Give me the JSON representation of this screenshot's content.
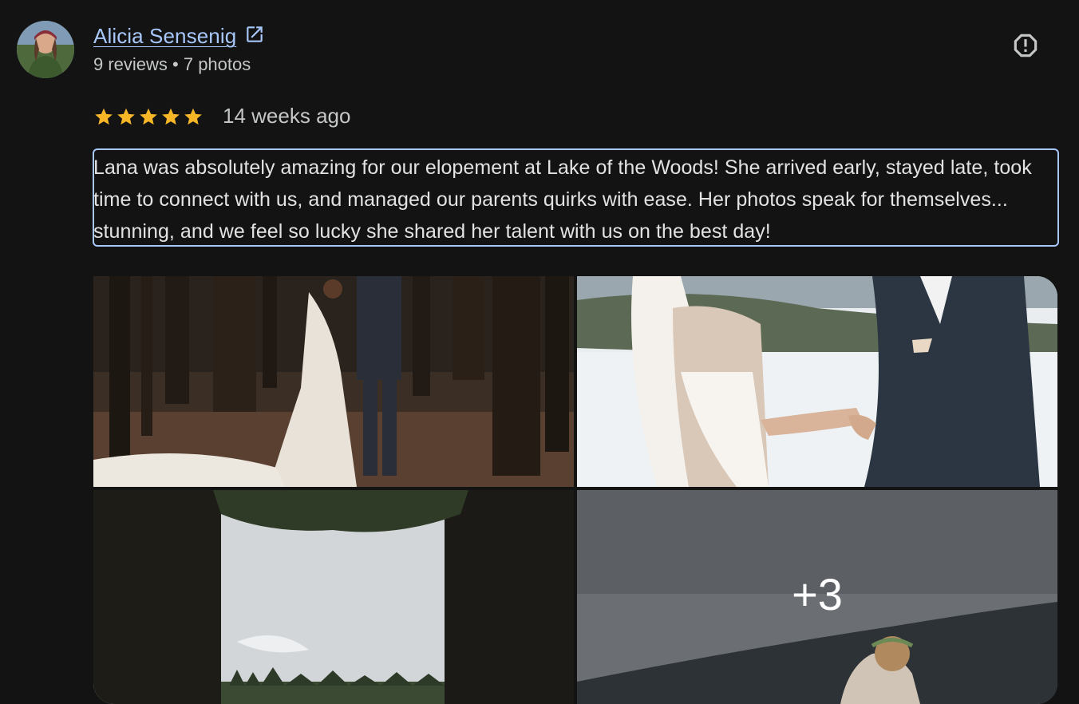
{
  "reviewer": {
    "name": "Alicia Sensenig",
    "meta": "9 reviews • 7 photos",
    "avatar_icon": "person-avatar"
  },
  "actions": {
    "report_icon": "report-icon",
    "external_link_icon": "open-in-new-icon"
  },
  "rating": {
    "stars": 5,
    "date": "14 weeks ago",
    "star_color": "#f6b628"
  },
  "review": {
    "text": "Lana was absolutely amazing for our elopement at Lake of the Woods! She arrived early, stayed late, took time to connect with us, and managed our parents quirks with ease. Her photos speak for themselves... stunning, and we feel so lucky she shared her talent with us on the best day!"
  },
  "photos": {
    "more_label": "+3"
  },
  "colors": {
    "background": "#131314",
    "link": "#a8c7fa",
    "secondary_text": "#c4c7c5"
  }
}
